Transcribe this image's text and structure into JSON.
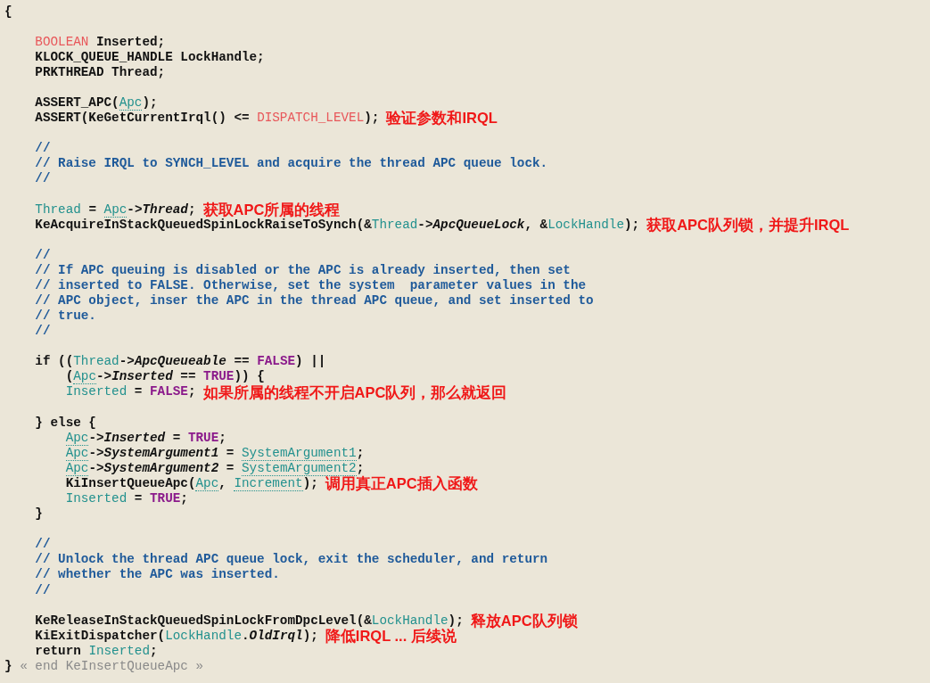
{
  "code_lines": [
    {
      "kind": "code",
      "tokens": [
        {
          "kind": "text",
          "text": "{"
        }
      ],
      "children": [
        {
          "kind": "blank"
        },
        {
          "kind": "code",
          "tokens": [
            {
              "kind": "keyword",
              "text": "BOOLEAN"
            },
            {
              "kind": "text",
              "text": " Inserted;"
            }
          ]
        },
        {
          "kind": "code",
          "tokens": [
            {
              "kind": "text",
              "text": "KLOCK_QUEUE_HANDLE LockHandle;"
            }
          ]
        },
        {
          "kind": "code",
          "tokens": [
            {
              "kind": "text",
              "text": "PRKTHREAD Thread;"
            }
          ]
        },
        {
          "kind": "blank"
        },
        {
          "kind": "code",
          "tokens": [
            {
              "kind": "text",
              "text": "ASSERT_APC("
            },
            {
              "kind": "param",
              "text": "Apc"
            },
            {
              "kind": "text",
              "text": ");"
            }
          ]
        },
        {
          "kind": "code",
          "tokens": [
            {
              "kind": "text",
              "text": "ASSERT(KeGetCurrentIrql() <= "
            },
            {
              "kind": "keyword",
              "text": "DISPATCH_LEVEL"
            },
            {
              "kind": "text",
              "text": ");"
            }
          ],
          "note": "验证参数和IRQL"
        },
        {
          "kind": "blank"
        },
        {
          "kind": "code",
          "tokens": [
            {
              "kind": "comment",
              "text": "//"
            }
          ]
        },
        {
          "kind": "code",
          "tokens": [
            {
              "kind": "comment",
              "text": "// Raise IRQL to SYNCH_LEVEL and acquire the thread APC queue lock."
            }
          ]
        },
        {
          "kind": "code",
          "tokens": [
            {
              "kind": "comment",
              "text": "//"
            }
          ]
        },
        {
          "kind": "blank"
        },
        {
          "kind": "code",
          "tokens": [
            {
              "kind": "local",
              "text": "Thread"
            },
            {
              "kind": "text",
              "text": " = "
            },
            {
              "kind": "param",
              "text": "Apc"
            },
            {
              "kind": "text",
              "text": "->"
            },
            {
              "kind": "member",
              "text": "Thread"
            },
            {
              "kind": "text",
              "text": ";"
            }
          ],
          "note": "获取APC所属的线程"
        },
        {
          "kind": "code",
          "tokens": [
            {
              "kind": "text",
              "text": "KeAcquireInStackQueuedSpinLockRaiseToSynch(&"
            },
            {
              "kind": "local",
              "text": "Thread"
            },
            {
              "kind": "text",
              "text": "->"
            },
            {
              "kind": "member",
              "text": "ApcQueueLock"
            },
            {
              "kind": "text",
              "text": ", &"
            },
            {
              "kind": "local",
              "text": "LockHandle"
            },
            {
              "kind": "text",
              "text": ");"
            }
          ],
          "note": "获取APC队列锁，并提升IRQL"
        },
        {
          "kind": "blank"
        },
        {
          "kind": "code",
          "tokens": [
            {
              "kind": "comment",
              "text": "//"
            }
          ]
        },
        {
          "kind": "code",
          "tokens": [
            {
              "kind": "comment",
              "text": "// If APC queuing is disabled or the APC is already inserted, then set"
            }
          ]
        },
        {
          "kind": "code",
          "tokens": [
            {
              "kind": "comment",
              "text": "// inserted to FALSE. Otherwise, set the system  parameter values in the"
            }
          ]
        },
        {
          "kind": "code",
          "tokens": [
            {
              "kind": "comment",
              "text": "// APC object, inser the APC in the thread APC queue, and set inserted to"
            }
          ]
        },
        {
          "kind": "code",
          "tokens": [
            {
              "kind": "comment",
              "text": "// true."
            }
          ]
        },
        {
          "kind": "code",
          "tokens": [
            {
              "kind": "comment",
              "text": "//"
            }
          ]
        },
        {
          "kind": "blank"
        },
        {
          "kind": "code",
          "tokens": [
            {
              "kind": "text",
              "text": "if (("
            },
            {
              "kind": "local",
              "text": "Thread"
            },
            {
              "kind": "text",
              "text": "->"
            },
            {
              "kind": "member",
              "text": "ApcQueueable"
            },
            {
              "kind": "text",
              "text": " == "
            },
            {
              "kind": "constant",
              "text": "FALSE"
            },
            {
              "kind": "text",
              "text": ") ||"
            }
          ],
          "children": [
            {
              "kind": "code",
              "tokens": [
                {
                  "kind": "text",
                  "text": "("
                },
                {
                  "kind": "param",
                  "text": "Apc"
                },
                {
                  "kind": "text",
                  "text": "->"
                },
                {
                  "kind": "member",
                  "text": "Inserted"
                },
                {
                  "kind": "text",
                  "text": " == "
                },
                {
                  "kind": "constant",
                  "text": "TRUE"
                },
                {
                  "kind": "text",
                  "text": ")) {"
                }
              ]
            },
            {
              "kind": "code",
              "tokens": [
                {
                  "kind": "local",
                  "text": "Inserted"
                },
                {
                  "kind": "text",
                  "text": " = "
                },
                {
                  "kind": "constant",
                  "text": "FALSE"
                },
                {
                  "kind": "text",
                  "text": ";"
                }
              ],
              "note": "如果所属的线程不开启APC队列，那么就返回"
            },
            {
              "kind": "blank"
            }
          ]
        },
        {
          "kind": "code",
          "tokens": [
            {
              "kind": "text",
              "text": "} else {"
            }
          ],
          "children": [
            {
              "kind": "code",
              "tokens": [
                {
                  "kind": "param",
                  "text": "Apc"
                },
                {
                  "kind": "text",
                  "text": "->"
                },
                {
                  "kind": "member",
                  "text": "Inserted"
                },
                {
                  "kind": "text",
                  "text": " = "
                },
                {
                  "kind": "constant",
                  "text": "TRUE"
                },
                {
                  "kind": "text",
                  "text": ";"
                }
              ]
            },
            {
              "kind": "code",
              "tokens": [
                {
                  "kind": "param",
                  "text": "Apc"
                },
                {
                  "kind": "text",
                  "text": "->"
                },
                {
                  "kind": "member",
                  "text": "SystemArgument1"
                },
                {
                  "kind": "text",
                  "text": " = "
                },
                {
                  "kind": "param",
                  "text": "SystemArgument1"
                },
                {
                  "kind": "text",
                  "text": ";"
                }
              ]
            },
            {
              "kind": "code",
              "tokens": [
                {
                  "kind": "param",
                  "text": "Apc"
                },
                {
                  "kind": "text",
                  "text": "->"
                },
                {
                  "kind": "member",
                  "text": "SystemArgument2"
                },
                {
                  "kind": "text",
                  "text": " = "
                },
                {
                  "kind": "param",
                  "text": "SystemArgument2"
                },
                {
                  "kind": "text",
                  "text": ";"
                }
              ]
            },
            {
              "kind": "code",
              "tokens": [
                {
                  "kind": "text",
                  "text": "KiInsertQueueApc("
                },
                {
                  "kind": "param",
                  "text": "Apc"
                },
                {
                  "kind": "text",
                  "text": ", "
                },
                {
                  "kind": "param",
                  "text": "Increment"
                },
                {
                  "kind": "text",
                  "text": ");"
                }
              ],
              "note": "调用真正APC插入函数"
            },
            {
              "kind": "code",
              "tokens": [
                {
                  "kind": "local",
                  "text": "Inserted"
                },
                {
                  "kind": "text",
                  "text": " = "
                },
                {
                  "kind": "constant",
                  "text": "TRUE"
                },
                {
                  "kind": "text",
                  "text": ";"
                }
              ]
            }
          ]
        },
        {
          "kind": "code",
          "tokens": [
            {
              "kind": "text",
              "text": "}"
            }
          ]
        },
        {
          "kind": "blank"
        },
        {
          "kind": "code",
          "tokens": [
            {
              "kind": "comment",
              "text": "//"
            }
          ]
        },
        {
          "kind": "code",
          "tokens": [
            {
              "kind": "comment",
              "text": "// Unlock the thread APC queue lock, exit the scheduler, and return"
            }
          ]
        },
        {
          "kind": "code",
          "tokens": [
            {
              "kind": "comment",
              "text": "// whether the APC was inserted."
            }
          ]
        },
        {
          "kind": "code",
          "tokens": [
            {
              "kind": "comment",
              "text": "//"
            }
          ]
        },
        {
          "kind": "blank"
        },
        {
          "kind": "code",
          "tokens": [
            {
              "kind": "text",
              "text": "KeReleaseInStackQueuedSpinLockFromDpcLevel(&"
            },
            {
              "kind": "local",
              "text": "LockHandle"
            },
            {
              "kind": "text",
              "text": ");"
            }
          ],
          "note": "释放APC队列锁"
        },
        {
          "kind": "code",
          "tokens": [
            {
              "kind": "text",
              "text": "KiExitDispatcher("
            },
            {
              "kind": "local",
              "text": "LockHandle"
            },
            {
              "kind": "text",
              "text": "."
            },
            {
              "kind": "member",
              "text": "OldIrql"
            },
            {
              "kind": "text",
              "text": ");"
            }
          ],
          "note": "降低IRQL ... 后续说"
        },
        {
          "kind": "code",
          "tokens": [
            {
              "kind": "text",
              "text": "return "
            },
            {
              "kind": "local",
              "text": "Inserted"
            },
            {
              "kind": "text",
              "text": ";"
            }
          ]
        }
      ]
    },
    {
      "kind": "code",
      "tokens": [
        {
          "kind": "text",
          "text": "}"
        },
        {
          "kind": "fold",
          "text": " « end KeInsertQueueApc »"
        }
      ]
    }
  ]
}
